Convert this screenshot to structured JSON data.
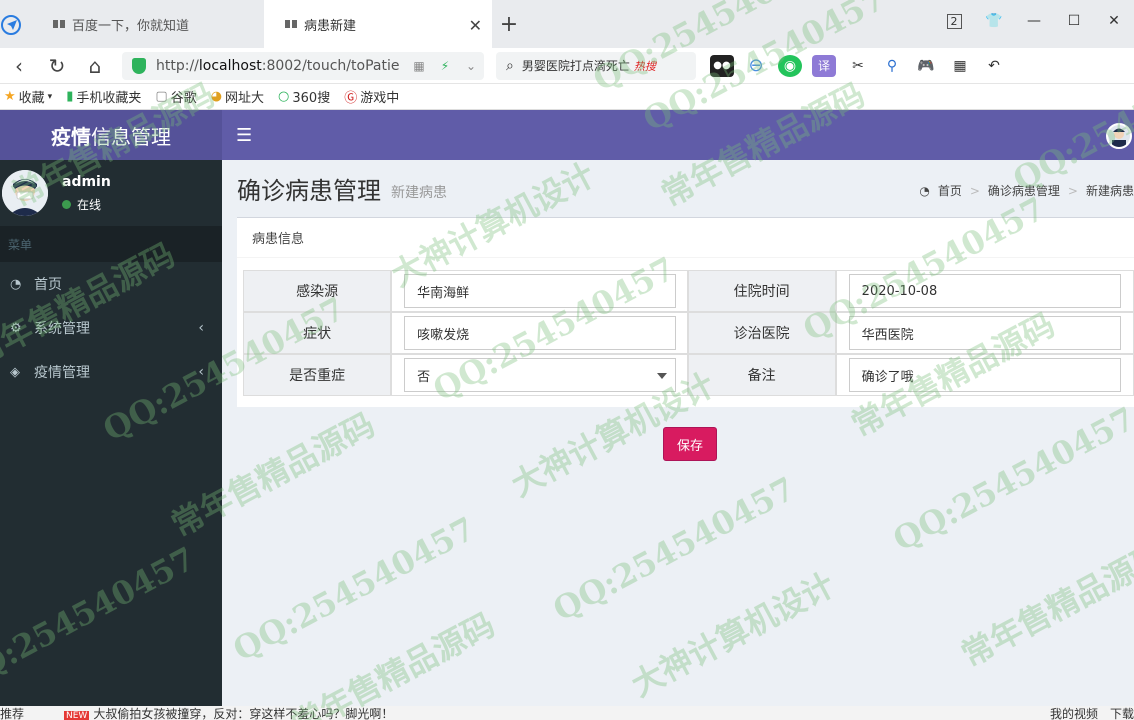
{
  "browser": {
    "tabs": [
      {
        "label": "百度一下，你就知道",
        "active": false
      },
      {
        "label": "病患新建",
        "active": true
      }
    ],
    "new_tab": "+",
    "url_prefix": "http://",
    "url_host": "localhost",
    "url_rest": ":8002/touch/toPatie",
    "search_text": "男婴医院打点滴死亡",
    "search_hot": "热搜",
    "tab_count": "2",
    "bookmarks": [
      "收藏",
      "手机收藏夹",
      "谷歌",
      "网址大",
      "360搜",
      "游戏中"
    ]
  },
  "app": {
    "logo_bold": "疫情",
    "logo_rest": "信息管理",
    "user": {
      "name": "admin",
      "status": "在线"
    },
    "menu_header": "菜单",
    "menu": [
      {
        "label": "首页",
        "icon": "dashboard-icon",
        "has_children": false
      },
      {
        "label": "系统管理",
        "icon": "cogs-icon",
        "has_children": true
      },
      {
        "label": "疫情管理",
        "icon": "cube-icon",
        "has_children": true
      }
    ],
    "page_title": "确诊病患管理",
    "page_subtitle": "新建病患",
    "breadcrumb": [
      "首页",
      "确诊病患管理",
      "新建病患"
    ],
    "box_title": "病患信息",
    "form": {
      "rows": [
        {
          "l1": "感染源",
          "v1": "华南海鲜",
          "l2": "住院时间",
          "v2": "2020-10-08"
        },
        {
          "l1": "症状",
          "v1": "咳嗽发烧",
          "l2": "诊治医院",
          "v2": "华西医院"
        },
        {
          "l1": "是否重症",
          "v1": "否",
          "l2": "备注",
          "v2": "确诊了哦"
        }
      ]
    },
    "save_label": "保存"
  },
  "statusbar": {
    "left": "推荐",
    "news_badge": "NEW",
    "news": "大叔偷拍女孩被撞穿，反对：穿这样不羞心吗？脚光啊！",
    "right": [
      "我的视频",
      "下载"
    ]
  },
  "watermark": {
    "texts": [
      "QQ:254540457",
      "常年售精品源码",
      "大神计算机设计"
    ]
  }
}
